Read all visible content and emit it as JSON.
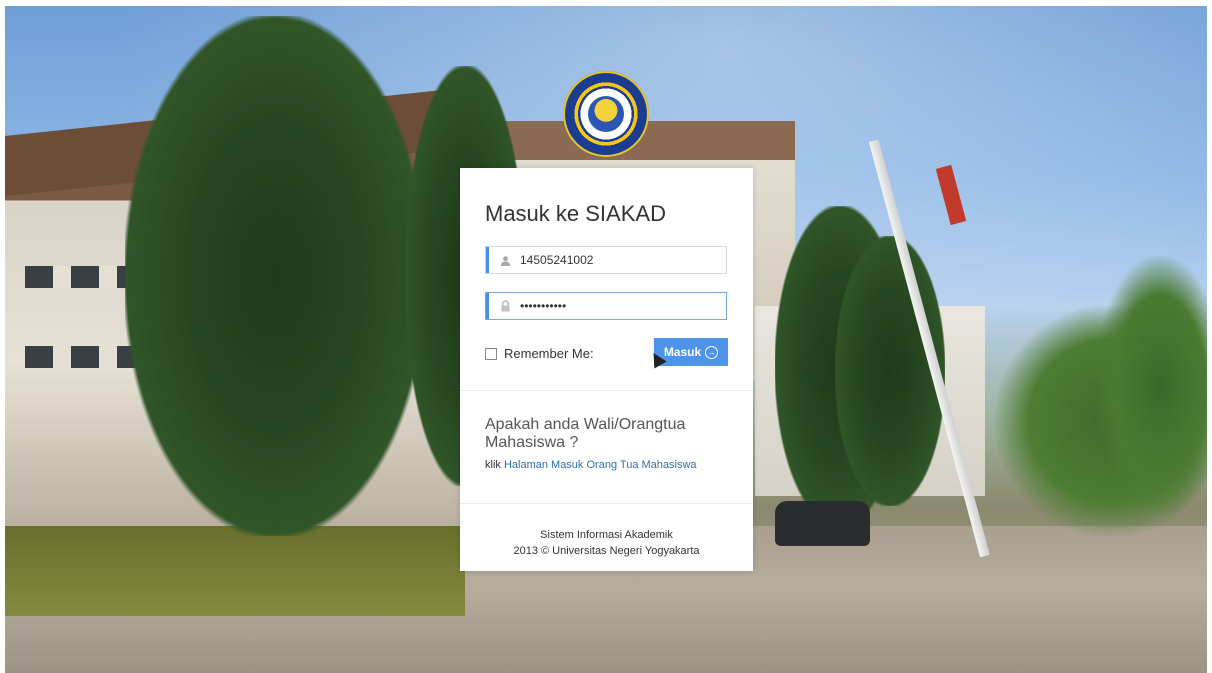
{
  "login": {
    "title": "Masuk ke SIAKAD",
    "username_value": "14505241002",
    "password_value": "•••••••••••",
    "remember_label": "Remember Me:",
    "submit_label": "Masuk",
    "remember_checked": false
  },
  "parent": {
    "question": "Apakah anda Wali/Orangtua Mahasiswa ?",
    "link_prefix": "klik",
    "link_text": "Halaman Masuk Orang Tua Mahasiswa"
  },
  "footer": {
    "line1": "Sistem Informasi Akademik",
    "line2": "2013 © Universitas Negeri Yogyakarta"
  },
  "logo": {
    "ring_text": "UNIVERSITAS NEGERI YOGYAKARTA"
  },
  "icons": {
    "user": "user-icon",
    "lock": "lock-icon",
    "arrow": "circle-arrow-right-icon"
  },
  "colors": {
    "accent": "#4d93ea",
    "link": "#2f6db0"
  }
}
